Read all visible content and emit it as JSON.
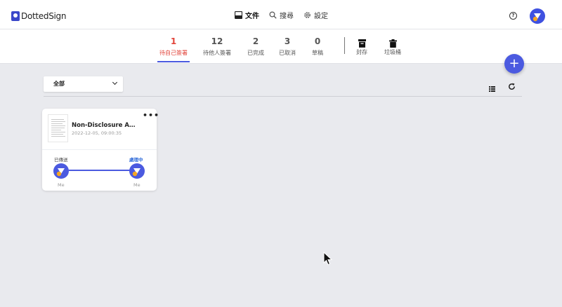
{
  "header": {
    "logo_text": "DottedSign",
    "nav": [
      {
        "label": "文件",
        "icon": "inbox-icon",
        "active": true
      },
      {
        "label": "搜尋",
        "icon": "search-icon",
        "active": false
      },
      {
        "label": "設定",
        "icon": "gear-icon",
        "active": false
      }
    ],
    "help_glyph": "?"
  },
  "tabs": [
    {
      "count": "1",
      "label": "待自己簽署",
      "active": true
    },
    {
      "count": "12",
      "label": "待他人簽署"
    },
    {
      "count": "2",
      "label": "已完成"
    },
    {
      "count": "3",
      "label": "已取消"
    },
    {
      "count": "0",
      "label": "草稿"
    }
  ],
  "icon_tabs": [
    {
      "label": "封存",
      "icon": "archive-icon"
    },
    {
      "label": "垃圾桶",
      "icon": "trash-icon"
    }
  ],
  "fab_glyph": "+",
  "toolbar": {
    "filter_value": "全部"
  },
  "documents": [
    {
      "title": "Non-Disclosure Agreement",
      "date": "2022-12-05, 09:00:35",
      "more_glyph": "•••",
      "status_left": "已傳送",
      "status_right": "處理中",
      "signer_left": "Me",
      "signer_right": "Me"
    }
  ],
  "colors": {
    "accent": "#4b5ae0",
    "active_tab": "#e2453b",
    "status_processing": "#2f6bd9",
    "avatar_dot": "#f5a623"
  }
}
